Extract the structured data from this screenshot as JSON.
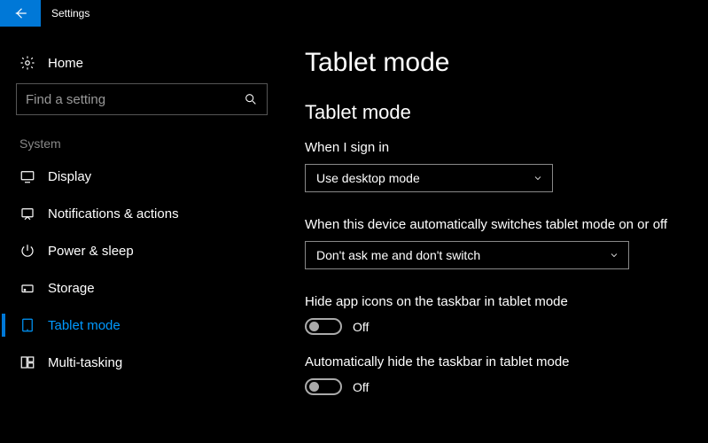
{
  "app": {
    "title": "Settings"
  },
  "home": {
    "label": "Home"
  },
  "search": {
    "placeholder": "Find a setting"
  },
  "category": {
    "label": "System"
  },
  "nav": {
    "items": [
      {
        "label": "Display"
      },
      {
        "label": "Notifications & actions"
      },
      {
        "label": "Power & sleep"
      },
      {
        "label": "Storage"
      },
      {
        "label": "Tablet mode"
      },
      {
        "label": "Multi-tasking"
      }
    ],
    "active_index": 4
  },
  "page": {
    "title": "Tablet mode",
    "section_title": "Tablet mode",
    "signin": {
      "label": "When I sign in",
      "value": "Use desktop mode"
    },
    "autoswitch": {
      "label": "When this device automatically switches tablet mode on or off",
      "value": "Don't ask me and don't switch"
    },
    "hide_icons": {
      "label": "Hide app icons on the taskbar in tablet mode",
      "state": "Off"
    },
    "hide_taskbar": {
      "label": "Automatically hide the taskbar in tablet mode",
      "state": "Off"
    }
  }
}
